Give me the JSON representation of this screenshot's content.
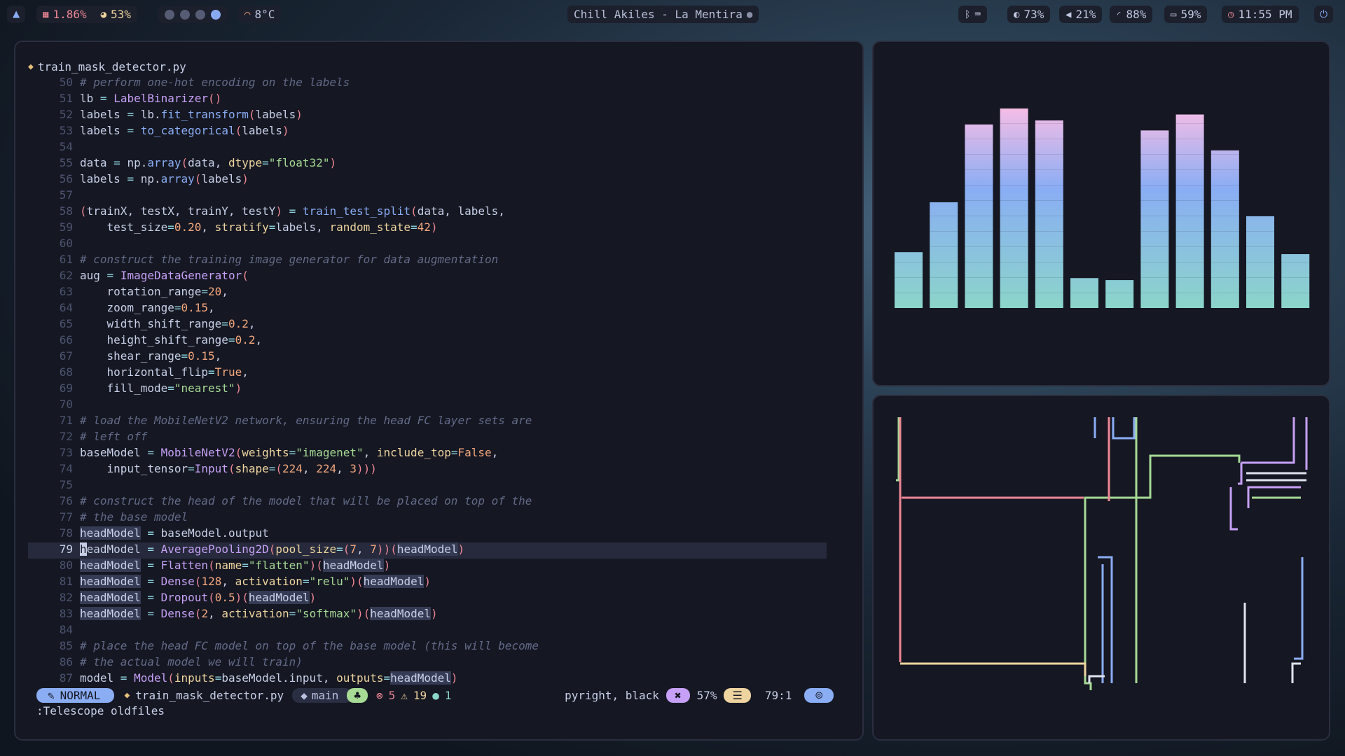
{
  "topbar": {
    "launcher_icon": "arch-logo-icon",
    "cpu": "1.86%",
    "mem": "53%",
    "workspaces": [
      {
        "active": false
      },
      {
        "active": false
      },
      {
        "active": false
      },
      {
        "active": true
      }
    ],
    "weather": "8°C",
    "media": "Chill Akiles - La Mentira",
    "brightness": "73%",
    "volume": "21%",
    "wifi": "88%",
    "battery": "59%",
    "clock": "11:55 PM"
  },
  "editor": {
    "filename": "train_mask_detector.py",
    "cursor_line": 79,
    "lines": [
      {
        "n": 50,
        "t": "# perform one-hot encoding on the labels"
      },
      {
        "n": 51,
        "t": "lb = LabelBinarizer()"
      },
      {
        "n": 52,
        "t": "labels = lb.fit_transform(labels)"
      },
      {
        "n": 53,
        "t": "labels = to_categorical(labels)"
      },
      {
        "n": 54,
        "t": ""
      },
      {
        "n": 55,
        "t": "data = np.array(data, dtype=\"float32\")"
      },
      {
        "n": 56,
        "t": "labels = np.array(labels)"
      },
      {
        "n": 57,
        "t": ""
      },
      {
        "n": 58,
        "t": "(trainX, testX, trainY, testY) = train_test_split(data, labels,"
      },
      {
        "n": 59,
        "t": "    test_size=0.20, stratify=labels, random_state=42)"
      },
      {
        "n": 60,
        "t": ""
      },
      {
        "n": 61,
        "t": "# construct the training image generator for data augmentation"
      },
      {
        "n": 62,
        "t": "aug = ImageDataGenerator("
      },
      {
        "n": 63,
        "t": "    rotation_range=20,"
      },
      {
        "n": 64,
        "t": "    zoom_range=0.15,"
      },
      {
        "n": 65,
        "t": "    width_shift_range=0.2,"
      },
      {
        "n": 66,
        "t": "    height_shift_range=0.2,"
      },
      {
        "n": 67,
        "t": "    shear_range=0.15,"
      },
      {
        "n": 68,
        "t": "    horizontal_flip=True,"
      },
      {
        "n": 69,
        "t": "    fill_mode=\"nearest\")"
      },
      {
        "n": 70,
        "t": ""
      },
      {
        "n": 71,
        "t": "# load the MobileNetV2 network, ensuring the head FC layer sets are"
      },
      {
        "n": 72,
        "t": "# left off"
      },
      {
        "n": 73,
        "t": "baseModel = MobileNetV2(weights=\"imagenet\", include_top=False,"
      },
      {
        "n": 74,
        "t": "    input_tensor=Input(shape=(224, 224, 3)))"
      },
      {
        "n": 75,
        "t": ""
      },
      {
        "n": 76,
        "t": "# construct the head of the model that will be placed on top of the"
      },
      {
        "n": 77,
        "t": "# the base model"
      },
      {
        "n": 78,
        "t": "headModel = baseModel.output"
      },
      {
        "n": 79,
        "t": "headModel = AveragePooling2D(pool_size=(7, 7))(headModel)"
      },
      {
        "n": 80,
        "t": "headModel = Flatten(name=\"flatten\")(headModel)"
      },
      {
        "n": 81,
        "t": "headModel = Dense(128, activation=\"relu\")(headModel)"
      },
      {
        "n": 82,
        "t": "headModel = Dropout(0.5)(headModel)"
      },
      {
        "n": 83,
        "t": "headModel = Dense(2, activation=\"softmax\")(headModel)"
      },
      {
        "n": 84,
        "t": ""
      },
      {
        "n": 85,
        "t": "# place the head FC model on top of the base model (this will become"
      },
      {
        "n": 86,
        "t": "# the actual model we will train)"
      },
      {
        "n": 87,
        "t": "model = Model(inputs=baseModel.input, outputs=headModel)"
      }
    ]
  },
  "statusline": {
    "mode": "NORMAL",
    "file": "train_mask_detector.py",
    "branch": "main",
    "errors": "5",
    "warnings": "19",
    "hints": "1",
    "lsp": "pyright, black",
    "percent": "57%",
    "position": "79:1"
  },
  "cmdline": ":Telescope oldfiles",
  "visualizer": {
    "bar_levels": [
      0.28,
      0.53,
      0.92,
      1.0,
      0.94,
      0.15,
      0.14,
      0.89,
      0.97,
      0.79,
      0.46,
      0.27
    ]
  },
  "colors": {
    "accent": "#8aadf4",
    "bar_top": "#f5bde6",
    "bar_bottom": "#8bd5ca",
    "pipe_green": "#a6da95",
    "pipe_red": "#ed8796",
    "pipe_blue": "#8aadf4",
    "pipe_purple": "#c6a0f6",
    "pipe_yellow": "#eed49f"
  }
}
